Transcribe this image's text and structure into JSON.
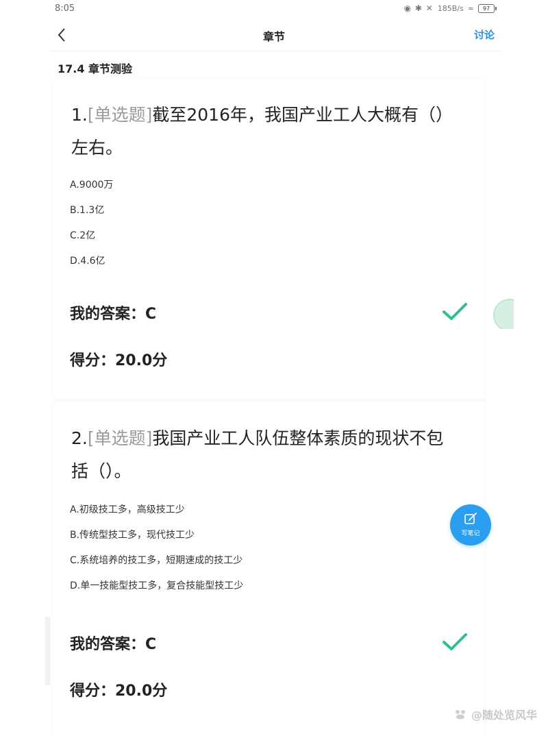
{
  "status_bar": {
    "time": "8:05",
    "network_speed": "185B/s",
    "battery": "97"
  },
  "header": {
    "title": "章节",
    "discuss_label": "讨论"
  },
  "chapter": {
    "heading": "17.4 章节测验"
  },
  "questions": [
    {
      "number": "1.",
      "type_label": "[单选题]",
      "text": "截至2016年，我国产业工人大概有（）左右。",
      "options": [
        "A.9000万",
        "B.1.3亿",
        "C.2亿",
        "D.4.6亿"
      ],
      "my_answer": "我的答案：C",
      "score": "得分：20.0分"
    },
    {
      "number": "2.",
      "type_label": "[单选题]",
      "text": "我国产业工人队伍整体素质的现状不包括（）。",
      "options": [
        "A.初级技工多，高级技工少",
        "B.传统型技工多，现代技工少",
        "C.系统培养的技工多，短期速成的技工少",
        "D.单一技能型技工多，复合技能型技工少"
      ],
      "my_answer": "我的答案：C",
      "score": "得分：20.0分"
    }
  ],
  "floating": {
    "note_label": "写笔记"
  },
  "watermark": {
    "text": "@随处览风华"
  },
  "colors": {
    "accent": "#2b9ef0",
    "correct": "#2fbf8a",
    "type_label": "#9a9a9a"
  }
}
